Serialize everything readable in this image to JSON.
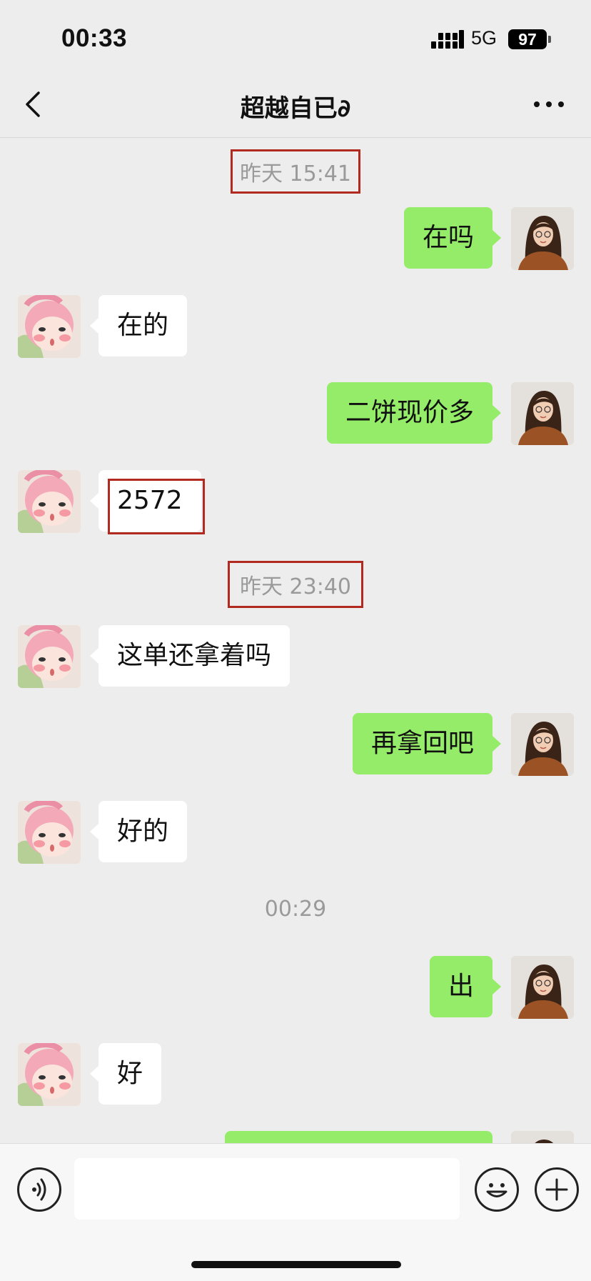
{
  "status_bar": {
    "time": "00:33",
    "network": "5G",
    "battery": "97"
  },
  "nav": {
    "title": "超越自已∂"
  },
  "timestamps": [
    "昨天 15:41",
    "昨天 23:40",
    "00:29"
  ],
  "messages": [
    {
      "side": "right",
      "text": "在吗"
    },
    {
      "side": "left",
      "text": "在的"
    },
    {
      "side": "right",
      "text": "二饼现价多"
    },
    {
      "side": "left",
      "text": "2572"
    },
    {
      "side": "left",
      "text": "这单还拿着吗"
    },
    {
      "side": "right",
      "text": "再拿回吧"
    },
    {
      "side": "left",
      "text": "好的"
    },
    {
      "side": "right",
      "text": "出"
    },
    {
      "side": "left",
      "text": "好"
    },
    {
      "side": "right",
      "text": ""
    }
  ],
  "colors": {
    "background": "#ededed",
    "sent_bubble": "#95ec69",
    "received_bubble": "#ffffff",
    "highlight_box": "#b22a1f"
  },
  "icons": {
    "back": "chevron-left-icon",
    "more": "more-dots-icon",
    "voice": "voice-icon",
    "emoji": "emoji-icon",
    "add": "plus-icon"
  }
}
